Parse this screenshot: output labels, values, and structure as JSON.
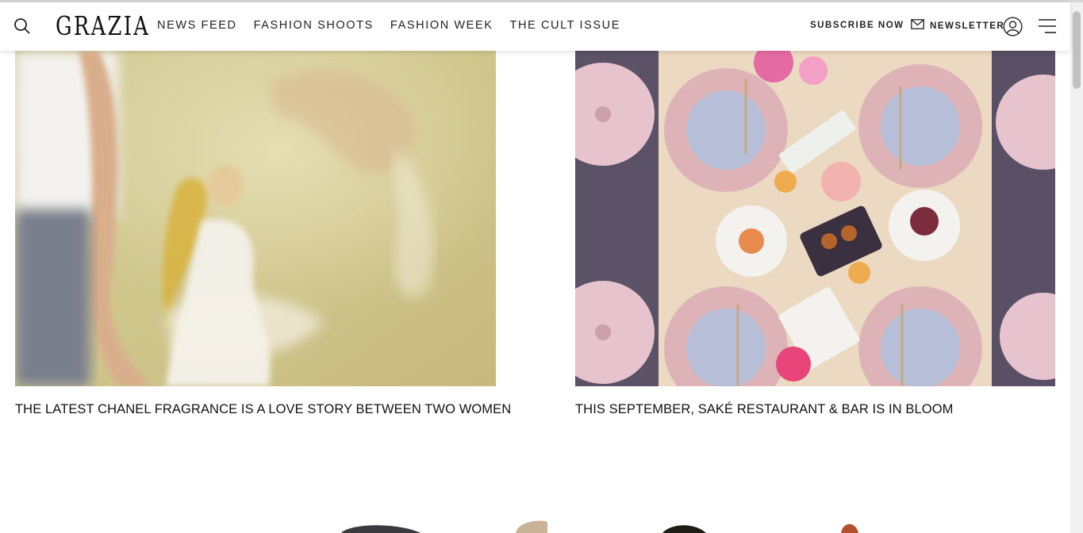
{
  "header": {
    "logo": "GRAZIA",
    "nav": [
      {
        "label": "NEWS FEED"
      },
      {
        "label": "FASHION SHOOTS"
      },
      {
        "label": "FASHION WEEK"
      },
      {
        "label": "THE CULT ISSUE"
      }
    ],
    "subscribe_label": "SUBSCRIBE NOW",
    "newsletter_label": "NEWSLETTER",
    "icons": {
      "search": "search-icon",
      "newsletter": "envelope-icon",
      "account": "user-icon",
      "menu": "hamburger-menu-icon"
    }
  },
  "articles": [
    {
      "title": "THE LATEST CHANEL FRAGRANCE IS A LOVE STORY BETWEEN TWO WOMEN"
    },
    {
      "title": "THIS SEPTEMBER, SAKÉ RESTAURANT & BAR IS IN BLOOM"
    }
  ],
  "colors": {
    "text": "#111111",
    "header_bg": "#ffffff"
  }
}
